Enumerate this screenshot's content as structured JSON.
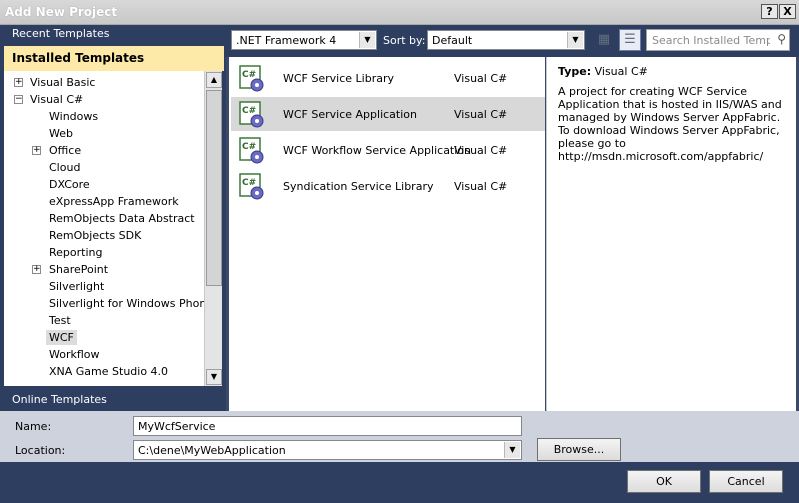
{
  "window": {
    "title": "Add New Project",
    "help_button": "?",
    "close_button": "X"
  },
  "left": {
    "recent_templates": "Recent Templates",
    "installed_templates": "Installed Templates",
    "online_templates": "Online Templates",
    "tree": [
      {
        "label": "Visual Basic",
        "expander": "+",
        "level": 0
      },
      {
        "label": "Visual C#",
        "expander": "−",
        "level": 0
      },
      {
        "label": "Windows",
        "level": 1
      },
      {
        "label": "Web",
        "level": 1
      },
      {
        "label": "Office",
        "expander": "+",
        "level": 1
      },
      {
        "label": "Cloud",
        "level": 1
      },
      {
        "label": "DXCore",
        "level": 1
      },
      {
        "label": "eXpressApp Framework",
        "level": 1
      },
      {
        "label": "RemObjects Data Abstract",
        "level": 1
      },
      {
        "label": "RemObjects SDK",
        "level": 1
      },
      {
        "label": "Reporting",
        "level": 1
      },
      {
        "label": "SharePoint",
        "expander": "+",
        "level": 1
      },
      {
        "label": "Silverlight",
        "level": 1
      },
      {
        "label": "Silverlight for Windows Phone",
        "level": 1
      },
      {
        "label": "Test",
        "level": 1
      },
      {
        "label": "WCF",
        "level": 1,
        "selected": true
      },
      {
        "label": "Workflow",
        "level": 1
      },
      {
        "label": "XNA Game Studio 4.0",
        "level": 1
      }
    ]
  },
  "toolbar": {
    "framework": ".NET Framework 4",
    "sort_by_label": "Sort by:",
    "sort_value": "Default",
    "search_placeholder": "Search Installed Templat"
  },
  "templates": [
    {
      "name": "WCF Service Library",
      "lang": "Visual C#"
    },
    {
      "name": "WCF Service Application",
      "lang": "Visual C#",
      "selected": true
    },
    {
      "name": "WCF Workflow Service Application",
      "lang": "Visual C#"
    },
    {
      "name": "Syndication Service Library",
      "lang": "Visual C#"
    }
  ],
  "description": {
    "type_label": "Type:",
    "type_value": "Visual C#",
    "text": "A project for creating WCF Service Application that is hosted in IIS/WAS and managed by Windows Server AppFabric.  To download Windows Server AppFabric, please go to http://msdn.microsoft.com/appfabric/"
  },
  "form": {
    "name_label": "Name:",
    "name_value": "MyWcfService",
    "location_label": "Location:",
    "location_value": "C:\\dene\\MyWebApplication",
    "browse_label": "Browse...",
    "ok_label": "OK",
    "cancel_label": "Cancel"
  }
}
